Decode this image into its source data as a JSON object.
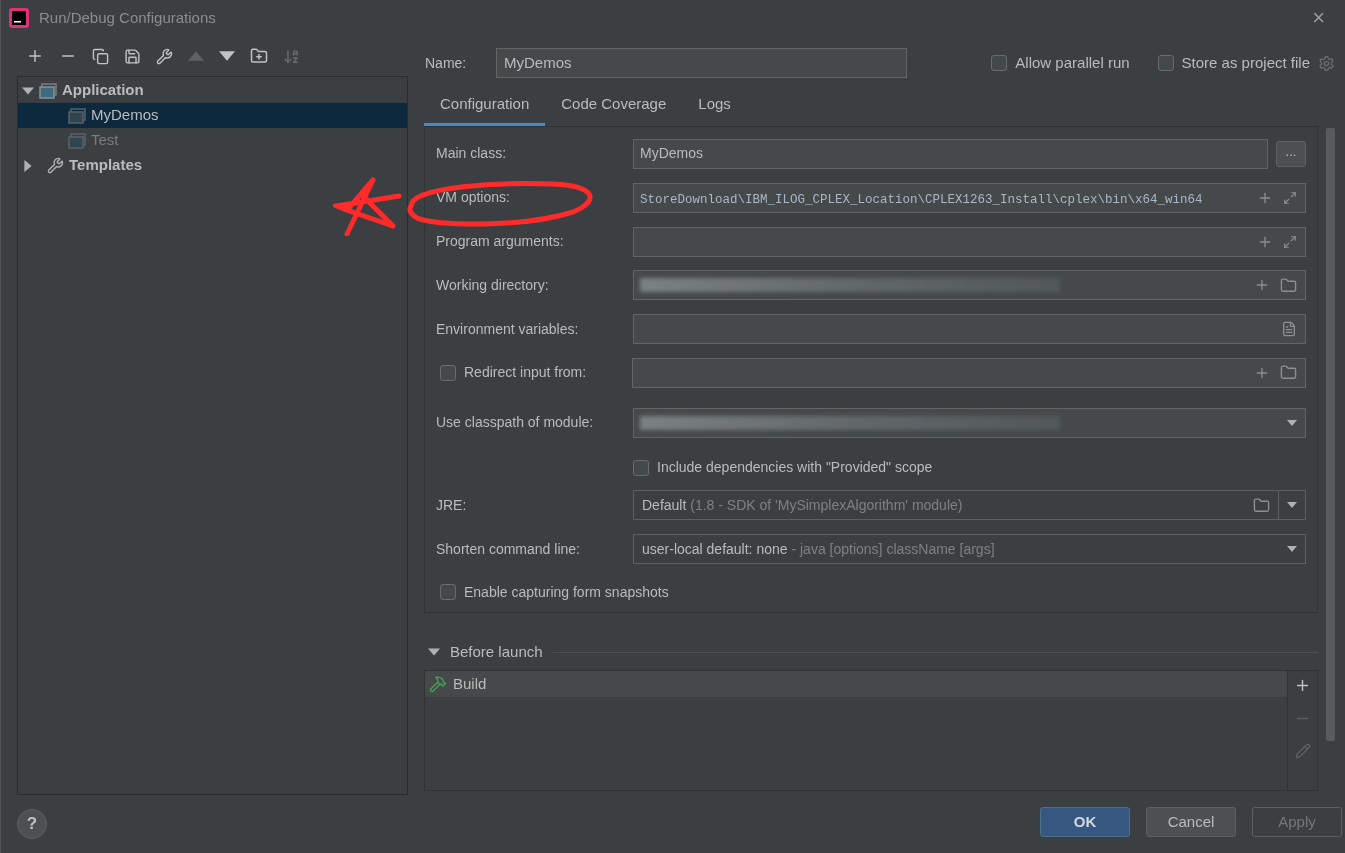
{
  "window": {
    "title": "Run/Debug Configurations",
    "close": "×"
  },
  "tree": [
    {
      "label": "Application",
      "kind": "app",
      "expanded": true,
      "children": [
        {
          "label": "MyDemos",
          "kind": "config",
          "selected": true,
          "temporary": false
        },
        {
          "label": "Test",
          "kind": "config",
          "selected": false,
          "temporary": true
        }
      ]
    },
    {
      "label": "Templates",
      "kind": "templates",
      "expanded": false
    }
  ],
  "name": {
    "label": "Name:",
    "value": "MyDemos"
  },
  "options": [
    {
      "label": "Allow parallel run",
      "checked": false
    },
    {
      "label": "Store as project file",
      "checked": false
    }
  ],
  "tabs": [
    {
      "label": "Configuration",
      "selected": true
    },
    {
      "label": "Code Coverage",
      "selected": false
    },
    {
      "label": "Logs",
      "selected": false
    }
  ],
  "form": {
    "rows": [
      {
        "kind": "class",
        "label": "Main class:",
        "value": "MyDemos",
        "button": "..."
      },
      {
        "kind": "expandable",
        "label": "VM options:",
        "value": "StoreDownload\\IBM_ILOG_CPLEX_Location\\CPLEX1263_Install\\cplex\\bin\\x64_win64"
      },
      {
        "kind": "expandable",
        "label": "Program arguments:"
      },
      {
        "kind": "directory",
        "label": "Working directory:",
        "redacted": true
      },
      {
        "kind": "env",
        "label": "Environment variables:"
      },
      {
        "kind": "redirect",
        "label": "Redirect input from:",
        "checked": false
      },
      {
        "kind": "module",
        "label": "Use classpath of module:",
        "redacted": true
      },
      {
        "kind": "check",
        "label": "Include dependencies with \"Provided\" scope",
        "checked": false
      },
      {
        "kind": "jre",
        "label": "JRE:",
        "value": "Default",
        "hint": "(1.8 - SDK of 'MySimplexAlgorithm' module)"
      },
      {
        "kind": "combo",
        "label": "Shorten command line:",
        "value": "user-local default: none",
        "hint": "- java [options] className [args]"
      },
      {
        "kind": "check-left",
        "label": "Enable capturing form snapshots",
        "checked": false
      }
    ]
  },
  "before_launch": {
    "label": "Before launch",
    "expanded": true,
    "items": [
      {
        "label": "Build",
        "selected": true
      }
    ]
  },
  "help": "?",
  "buttons": [
    {
      "label": "OK",
      "kind": "default",
      "disabled": false
    },
    {
      "label": "Cancel",
      "kind": "normal",
      "disabled": false
    },
    {
      "label": "Apply",
      "kind": "normal",
      "disabled": true
    }
  ]
}
